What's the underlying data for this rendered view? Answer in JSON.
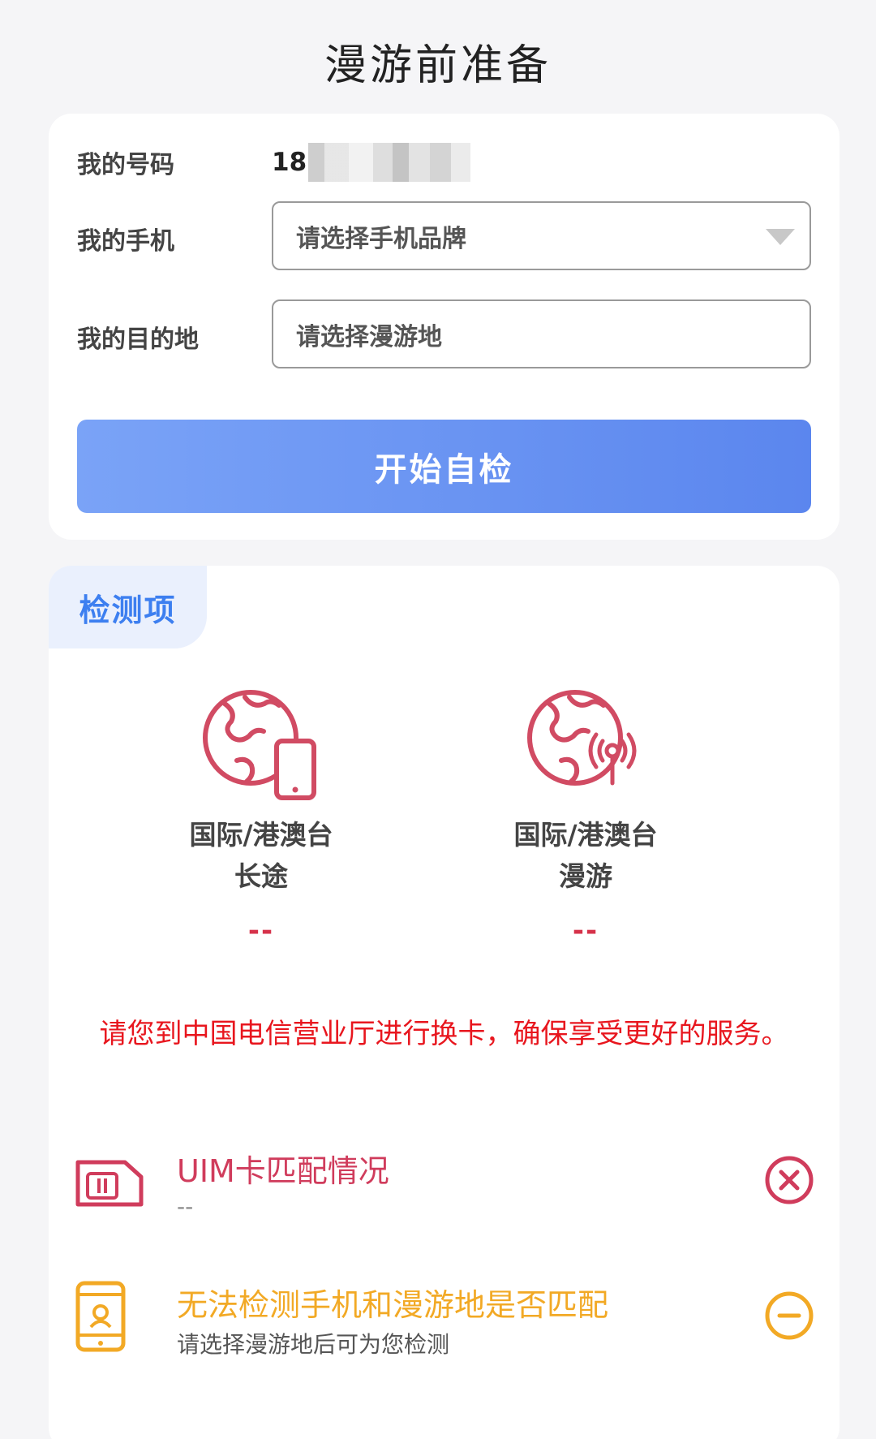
{
  "header": {
    "title": "漫游前准备"
  },
  "form": {
    "number_label": "我的号码",
    "number_value": "18",
    "phone_label": "我的手机",
    "phone_placeholder": "请选择手机品牌",
    "destination_label": "我的目的地",
    "destination_placeholder": "请选择漫游地",
    "start_button": "开始自检"
  },
  "checks": {
    "tab_label": "检测项",
    "features": [
      {
        "line1": "国际/港澳台",
        "line2": "长途",
        "status": "--",
        "icon": "globe-phone-icon"
      },
      {
        "line1": "国际/港澳台",
        "line2": "漫游",
        "status": "--",
        "icon": "globe-signal-icon"
      }
    ],
    "notice": "请您到中国电信营业厅进行换卡，确保享受更好的服务。",
    "items": [
      {
        "title": "UIM卡匹配情况",
        "subtitle": "--",
        "icon": "sim-card-icon",
        "status_icon": "close-circle-icon",
        "color": "#d03c5c"
      },
      {
        "title": "无法检测手机和漫游地是否匹配",
        "subtitle": "请选择漫游地后可为您检测",
        "icon": "phone-location-icon",
        "status_icon": "minus-circle-icon",
        "color": "#f2a925"
      }
    ]
  },
  "colors": {
    "primary": "#5b86ee",
    "tab_text": "#3d7ff0",
    "warning": "#e8161e",
    "error": "#d03c5c",
    "caution": "#f2a925"
  }
}
